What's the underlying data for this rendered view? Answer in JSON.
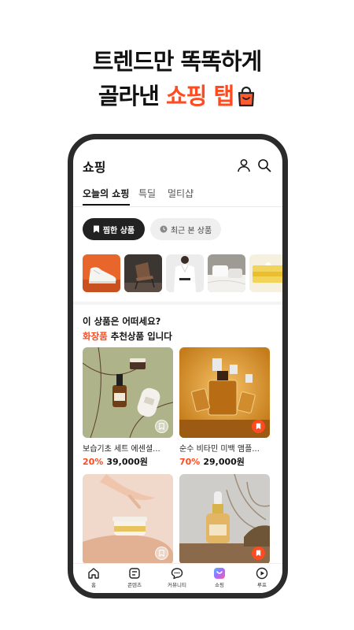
{
  "headline": {
    "line1": "트렌드만 똑똑하게",
    "line2_prefix": "골라낸 ",
    "line2_accent": "쇼핑 탭",
    "bag_icon": "shopping-bag-icon",
    "accent_color": "#ff4b1f"
  },
  "app": {
    "title": "쇼핑",
    "tabs": [
      {
        "label": "오늘의 쇼핑",
        "active": true
      },
      {
        "label": "특딜",
        "active": false
      },
      {
        "label": "멀티샵",
        "active": false
      }
    ],
    "pills": [
      {
        "label": "찜한 상품",
        "icon": "bookmark-icon",
        "selected": true
      },
      {
        "label": "최근 본 상품",
        "icon": "clock-icon",
        "selected": false
      }
    ],
    "recent_thumbs": [
      {
        "icon": "sneaker-thumbnail"
      },
      {
        "icon": "chair-thumbnail"
      },
      {
        "icon": "blouse-thumbnail"
      },
      {
        "icon": "bedding-thumbnail"
      },
      {
        "icon": "tissue-thumbnail"
      }
    ],
    "recommend": {
      "line1": "이 상품은 어떠세요?",
      "line2_highlight": "화장품",
      "line2_rest": " 추천상품 입니다"
    },
    "products": [
      {
        "name": "보습기초 세트 에센셜...",
        "discount": "20%",
        "price": "39,000원",
        "bookmarked": false
      },
      {
        "name": "순수 비타민 미백 앰플...",
        "discount": "70%",
        "price": "29,000원",
        "bookmarked": true
      },
      {
        "name": "",
        "discount": "",
        "price": "",
        "bookmarked": false
      },
      {
        "name": "",
        "discount": "",
        "price": "",
        "bookmarked": true
      }
    ],
    "bottom_nav": [
      {
        "label": "홈",
        "icon": "home-icon"
      },
      {
        "label": "콘텐츠",
        "icon": "content-icon"
      },
      {
        "label": "커뮤니티",
        "icon": "chat-icon"
      },
      {
        "label": "쇼핑",
        "icon": "shopping-icon"
      },
      {
        "label": "루프",
        "icon": "play-icon"
      }
    ]
  }
}
